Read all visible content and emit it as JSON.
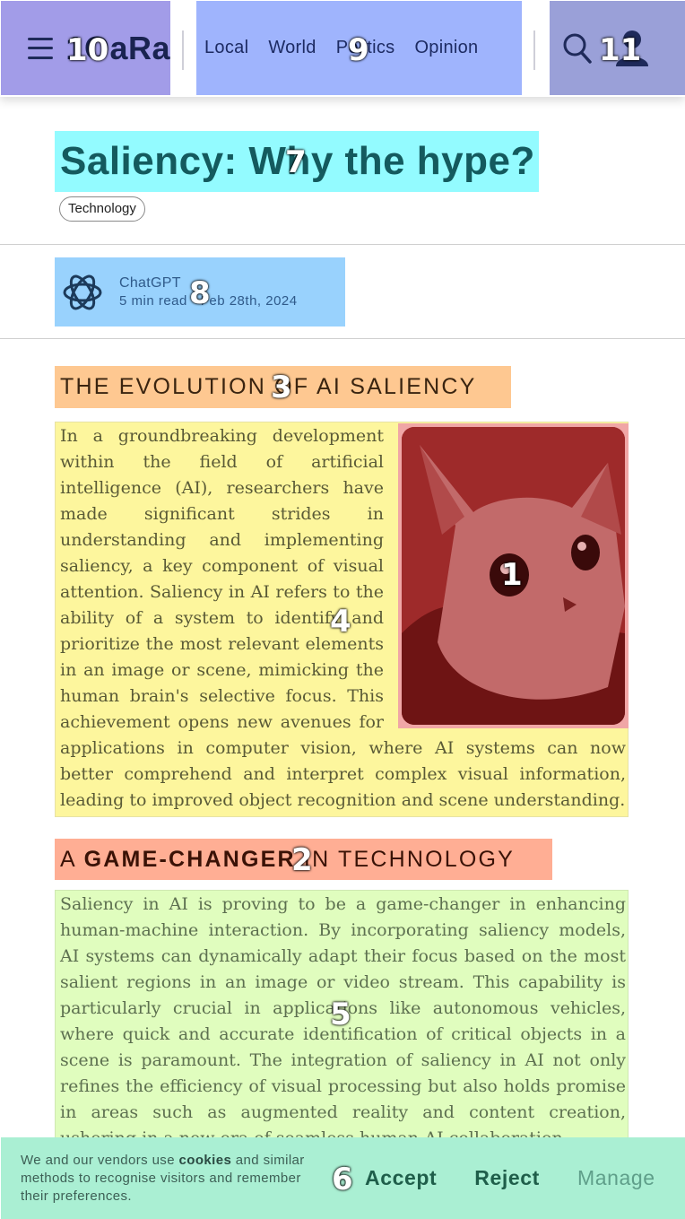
{
  "header": {
    "logo_text": "1OaRa",
    "nav_items": [
      "Local",
      "World",
      "Politics",
      "Opinion"
    ],
    "menu_icon": "hamburger-menu-icon",
    "search_icon": "search-icon",
    "account_icon": "user-account-icon"
  },
  "article": {
    "title": "Saliency: Why the hype?",
    "tag": "Technology",
    "author": {
      "avatar_icon": "openai-logo-icon",
      "name": "ChatGPT",
      "meta": "5 min read · Feb 28th, 2024"
    },
    "section1": {
      "heading": "THE EVOLUTION OF AI SALIENCY",
      "paragraph": "In a groundbreaking development within the field of artificial intelligence (AI), researchers have made significant strides in understanding and implementing saliency, a key component of visual attention. Saliency in AI refers to the ability of a system to identify and prioritize the most relevant elements in an image or scene, mimicking the human brain's selective focus. This achievement opens new avenues for applications in computer vision, where AI systems can now better comprehend and interpret complex visual information, leading to improved object recognition and scene understanding."
    },
    "image": {
      "subject": "cat-photo"
    },
    "section2": {
      "heading_pre": "A ",
      "heading_bold": "GAME-CHANGER",
      "heading_post": " IN TECHNOLOGY",
      "paragraph": "Saliency in AI is proving to be a game-changer in enhancing human-machine interaction. By incorporating saliency models, AI systems can dynamically adapt their focus based on the most salient regions in an image or video stream. This capability is particularly crucial in applications like autonomous vehicles, where quick and accurate identification of critical objects in a scene is paramount. The integration of saliency in AI not only refines the efficiency of visual processing but also holds promise in areas such as augmented reality and content creation, ushering in a new era of seamless human-AI collaboration."
    }
  },
  "cookie_banner": {
    "text_pre": "We and our vendors use ",
    "text_bold": "cookies",
    "text_post": " and similar methods to recognise visitors and remember their preferences.",
    "accept_label": "Accept",
    "reject_label": "Reject",
    "manage_label": "Manage"
  },
  "overlay_labels": [
    "1",
    "2",
    "3",
    "4",
    "5",
    "6",
    "7",
    "8",
    "9",
    "10",
    "11"
  ],
  "colors": {
    "logo_region": "#a29ce8",
    "nav_region": "#9fb4fd",
    "title_region": "#93fbff",
    "author_region": "#99d2fd",
    "heading1_region": "#fec891",
    "paragraph1_region": "#fdf69d",
    "image_region": "#f0a6a6",
    "heading2_region": "#ffae94",
    "paragraph2_region": "#e0fdbe",
    "cookie_region": "#aaefd3"
  }
}
